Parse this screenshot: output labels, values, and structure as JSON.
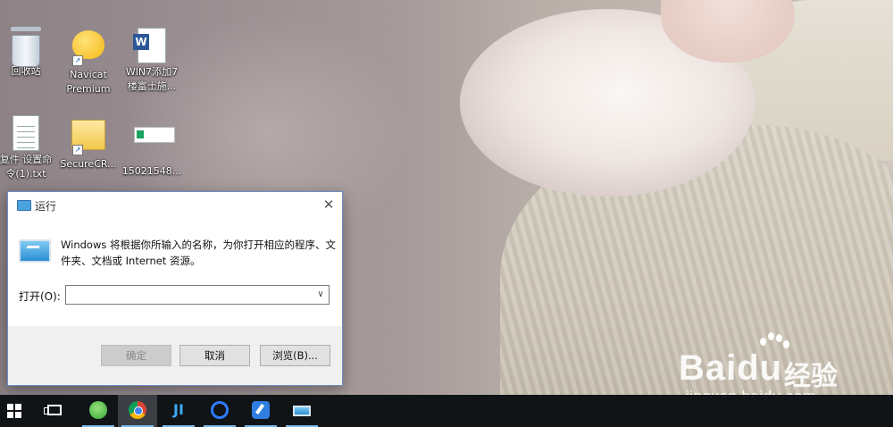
{
  "desktop": {
    "icons": [
      {
        "label": "回收站",
        "icon": "recycle-bin-icon"
      },
      {
        "label": "Navicat\nPremium",
        "icon": "navicat-icon"
      },
      {
        "label": "WIN7添加7\n楼富士施...",
        "icon": "word-document-icon"
      },
      {
        "label": "复件 设置命\n令(1).txt",
        "icon": "text-file-icon"
      },
      {
        "label": "SecureCR...",
        "icon": "folder-icon"
      },
      {
        "label": "15021548...",
        "icon": "image-file-icon"
      }
    ]
  },
  "run_dialog": {
    "title": "运行",
    "description": "Windows 将根据你所输入的名称，为你打开相应的程序、文件夹、文档或 Internet 资源。",
    "open_label": "打开(O):",
    "input_value": "",
    "buttons": {
      "ok": "确定",
      "cancel": "取消",
      "browse": "浏览(B)..."
    },
    "close_glyph": "✕"
  },
  "taskbar": {
    "items": [
      {
        "name": "start",
        "icon": "windows-logo-icon"
      },
      {
        "name": "task-view",
        "icon": "task-view-icon"
      },
      {
        "name": "green-app",
        "icon": "green-circle-app-icon"
      },
      {
        "name": "chrome",
        "icon": "chrome-icon"
      },
      {
        "name": "ji-app",
        "icon": "ji-app-icon",
        "glyph": "JI"
      },
      {
        "name": "baidu-netdisk",
        "icon": "baidu-netdisk-icon"
      },
      {
        "name": "note-app",
        "icon": "note-app-icon"
      },
      {
        "name": "run",
        "icon": "run-dialog-icon"
      }
    ]
  },
  "watermark": {
    "logo": "Bai",
    "logo_du": "du",
    "cn": "经验",
    "url": "jingyan.baidu.com"
  },
  "colors": {
    "taskbar": "#101417",
    "dialog_border": "#6b8fc6",
    "accent": "#76b9ed"
  }
}
